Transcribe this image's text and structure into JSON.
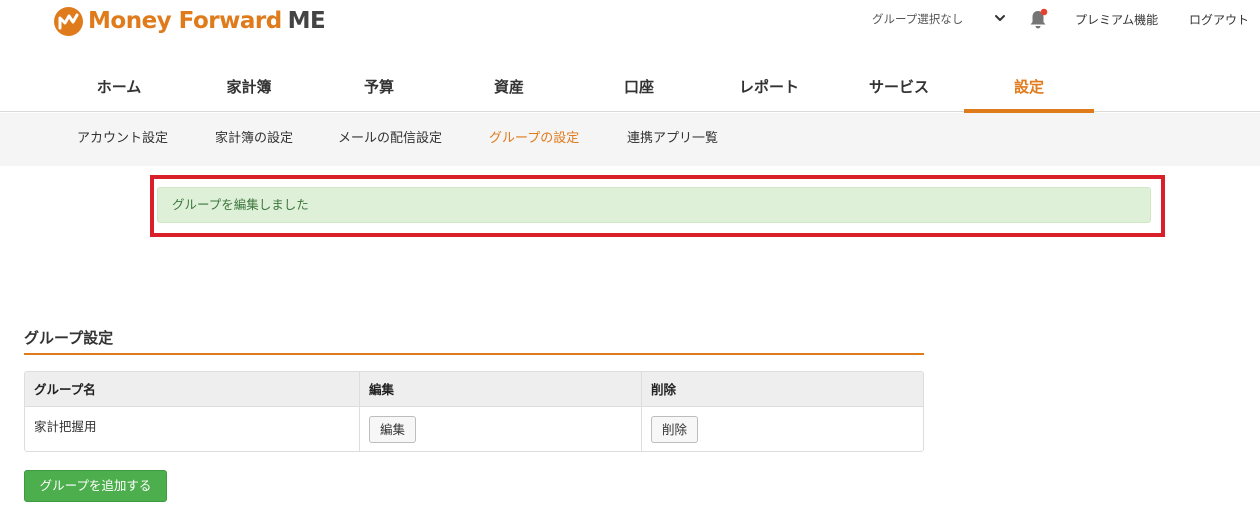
{
  "header": {
    "logo_text": "Money Forward",
    "logo_suffix": "ME",
    "group_select": "グループ選択なし",
    "premium": "プレミアム機能",
    "logout": "ログアウト"
  },
  "main_nav": [
    {
      "label": "ホーム",
      "active": false
    },
    {
      "label": "家計簿",
      "active": false
    },
    {
      "label": "予算",
      "active": false
    },
    {
      "label": "資産",
      "active": false
    },
    {
      "label": "口座",
      "active": false
    },
    {
      "label": "レポート",
      "active": false
    },
    {
      "label": "サービス",
      "active": false
    },
    {
      "label": "設定",
      "active": true
    }
  ],
  "sub_nav": [
    {
      "label": "アカウント設定",
      "active": false
    },
    {
      "label": "家計簿の設定",
      "active": false
    },
    {
      "label": "メールの配信設定",
      "active": false
    },
    {
      "label": "グループの設定",
      "active": true
    },
    {
      "label": "連携アプリ一覧",
      "active": false
    }
  ],
  "alert": {
    "message": "グループを編集しました"
  },
  "section": {
    "title": "グループ設定"
  },
  "table": {
    "headers": [
      "グループ名",
      "編集",
      "削除"
    ],
    "rows": [
      {
        "name": "家計把握用",
        "edit_label": "編集",
        "delete_label": "削除"
      }
    ]
  },
  "add_button": "グループを追加する",
  "colors": {
    "brand_orange": "#e07b1c",
    "success_bg": "#dff0d8",
    "success_text": "#3c763d",
    "highlight_red": "#d9202a",
    "add_button_green": "#4cae4c",
    "notification_dot": "#e8402f"
  },
  "icons": {
    "logo": "money-forward-logo-icon",
    "dropdown": "chevron-down-icon",
    "notifications": "bell-icon"
  }
}
